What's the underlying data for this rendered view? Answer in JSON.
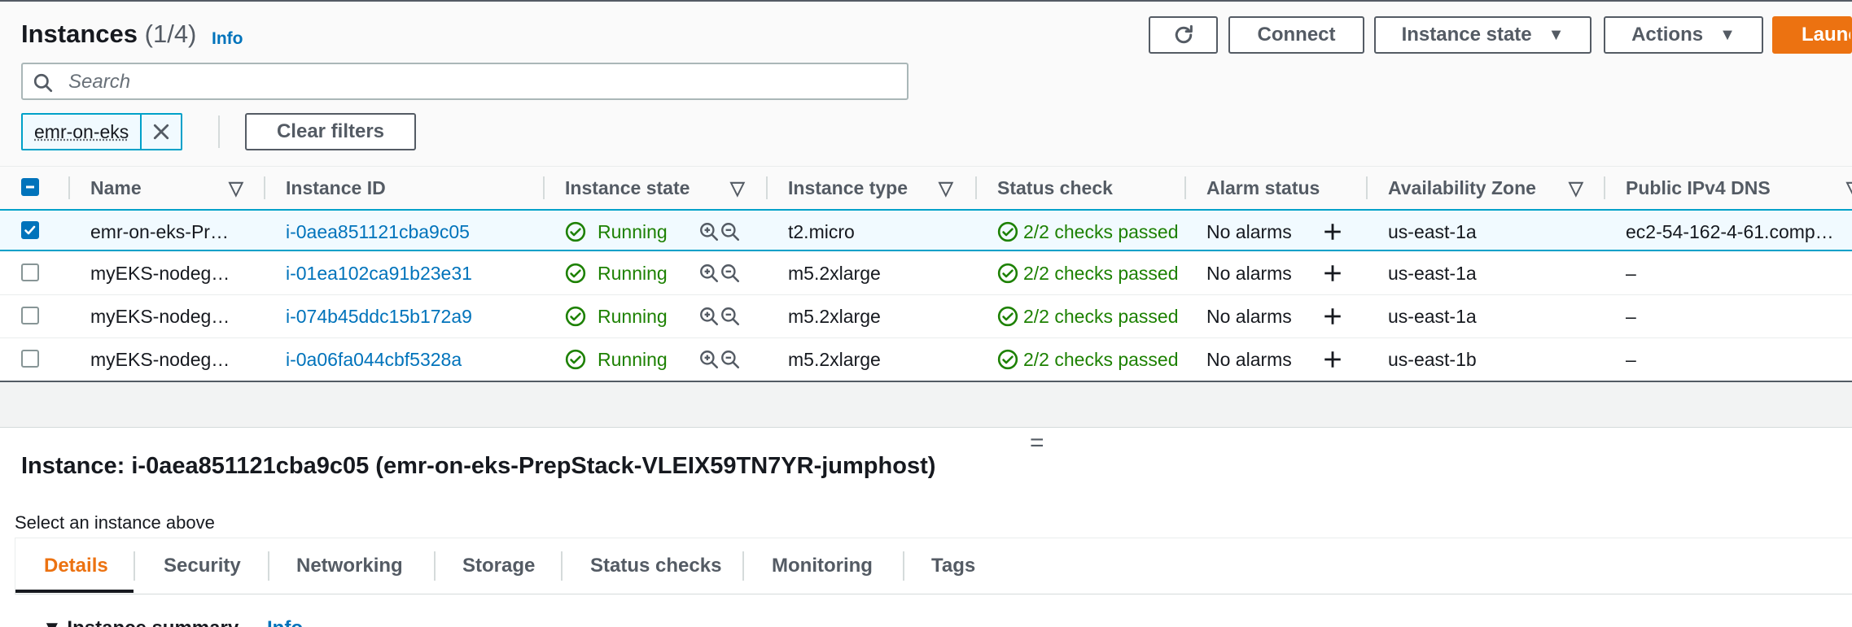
{
  "header": {
    "title": "Instances",
    "count": "(1/4)",
    "info_label": "Info"
  },
  "toolbar": {
    "connect_label": "Connect",
    "instance_state_label": "Instance state",
    "actions_label": "Actions",
    "launch_label": "Launch instances"
  },
  "search": {
    "placeholder": "Search"
  },
  "filters": {
    "token_label": "emr-on-eks",
    "clear_label": "Clear filters"
  },
  "table": {
    "columns": [
      "Name",
      "Instance ID",
      "Instance state",
      "Instance type",
      "Status check",
      "Alarm status",
      "Availability Zone",
      "Public IPv4 DNS"
    ],
    "rows": [
      {
        "name": "emr-on-eks-Pr…",
        "id": "i-0aea851121cba9c05",
        "state": "Running",
        "type": "t2.micro",
        "status": "2/2 checks passed",
        "alarm": "No alarms",
        "az": "us-east-1a",
        "dns": "ec2-54-162-4-61.comp…",
        "selected": true
      },
      {
        "name": "myEKS-nodeg…",
        "id": "i-01ea102ca91b23e31",
        "state": "Running",
        "type": "m5.2xlarge",
        "status": "2/2 checks passed",
        "alarm": "No alarms",
        "az": "us-east-1a",
        "dns": "–",
        "selected": false
      },
      {
        "name": "myEKS-nodeg…",
        "id": "i-074b45ddc15b172a9",
        "state": "Running",
        "type": "m5.2xlarge",
        "status": "2/2 checks passed",
        "alarm": "No alarms",
        "az": "us-east-1a",
        "dns": "–",
        "selected": false
      },
      {
        "name": "myEKS-nodeg…",
        "id": "i-0a06fa044cbf5328a",
        "state": "Running",
        "type": "m5.2xlarge",
        "status": "2/2 checks passed",
        "alarm": "No alarms",
        "az": "us-east-1b",
        "dns": "–",
        "selected": false
      }
    ]
  },
  "details": {
    "title": "Instance: i-0aea851121cba9c05 (emr-on-eks-PrepStack-VLEIX59TN7YR-jumphost)",
    "subtitle": "Select an instance above",
    "tabs": [
      "Details",
      "Security",
      "Networking",
      "Storage",
      "Status checks",
      "Monitoring",
      "Tags"
    ],
    "active_tab": "Details",
    "section_peek": "Info"
  },
  "colors": {
    "accent": "#ec7211",
    "link": "#0073bb",
    "success": "#1d8102",
    "selection": "#00a1c9"
  },
  "icons": [
    "refresh-icon",
    "search-icon",
    "close-icon",
    "caret-down-icon",
    "sort-icon",
    "check-circle-icon",
    "zoom-in-icon",
    "zoom-out-icon",
    "plus-icon",
    "drag-handle-icon"
  ]
}
